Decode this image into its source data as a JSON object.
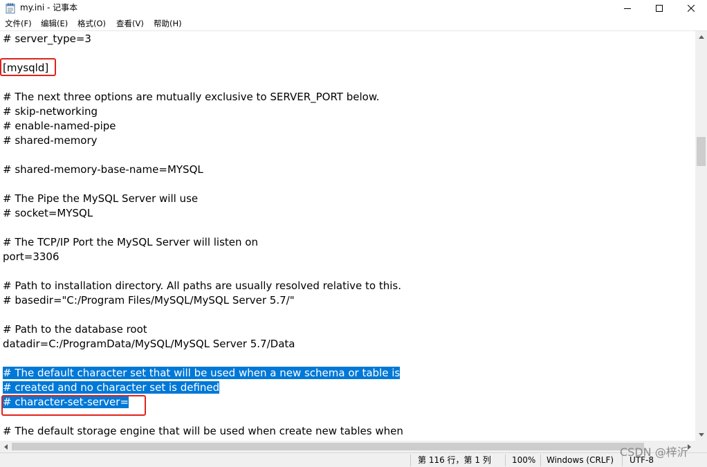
{
  "window": {
    "title": "my.ini - 记事本",
    "icons": [
      "notepad-icon",
      "minimize-icon",
      "maximize-icon",
      "close-icon"
    ]
  },
  "menu": {
    "items": [
      "文件(F)",
      "编辑(E)",
      "格式(O)",
      "查看(V)",
      "帮助(H)"
    ]
  },
  "editor": {
    "lines": [
      "# server_type=3",
      "",
      "[mysqld]",
      "",
      "# The next three options are mutually exclusive to SERVER_PORT below.",
      "# skip-networking",
      "# enable-named-pipe",
      "# shared-memory",
      "",
      "# shared-memory-base-name=MYSQL",
      "",
      "# The Pipe the MySQL Server will use",
      "# socket=MYSQL",
      "",
      "# The TCP/IP Port the MySQL Server will listen on",
      "port=3306",
      "",
      "# Path to installation directory. All paths are usually resolved relative to this.",
      "# basedir=\"C:/Program Files/MySQL/MySQL Server 5.7/\"",
      "",
      "# Path to the database root",
      "datadir=C:/ProgramData/MySQL/MySQL Server 5.7/Data",
      "",
      "# The default character set that will be used when a new schema or table is",
      "# created and no character set is defined",
      "# character-set-server=",
      "",
      "# The default storage engine that will be used when create new tables when"
    ],
    "selected_lines": [
      23,
      24,
      25
    ],
    "selection_color": "#0078d7",
    "annotation_color": "#e0211b"
  },
  "status": {
    "position": "第 116 行，第 1 列",
    "zoom": "100%",
    "line_ending": "Windows (CRLF)",
    "encoding": "UTF-8"
  },
  "watermark": "CSDN @梓沂"
}
